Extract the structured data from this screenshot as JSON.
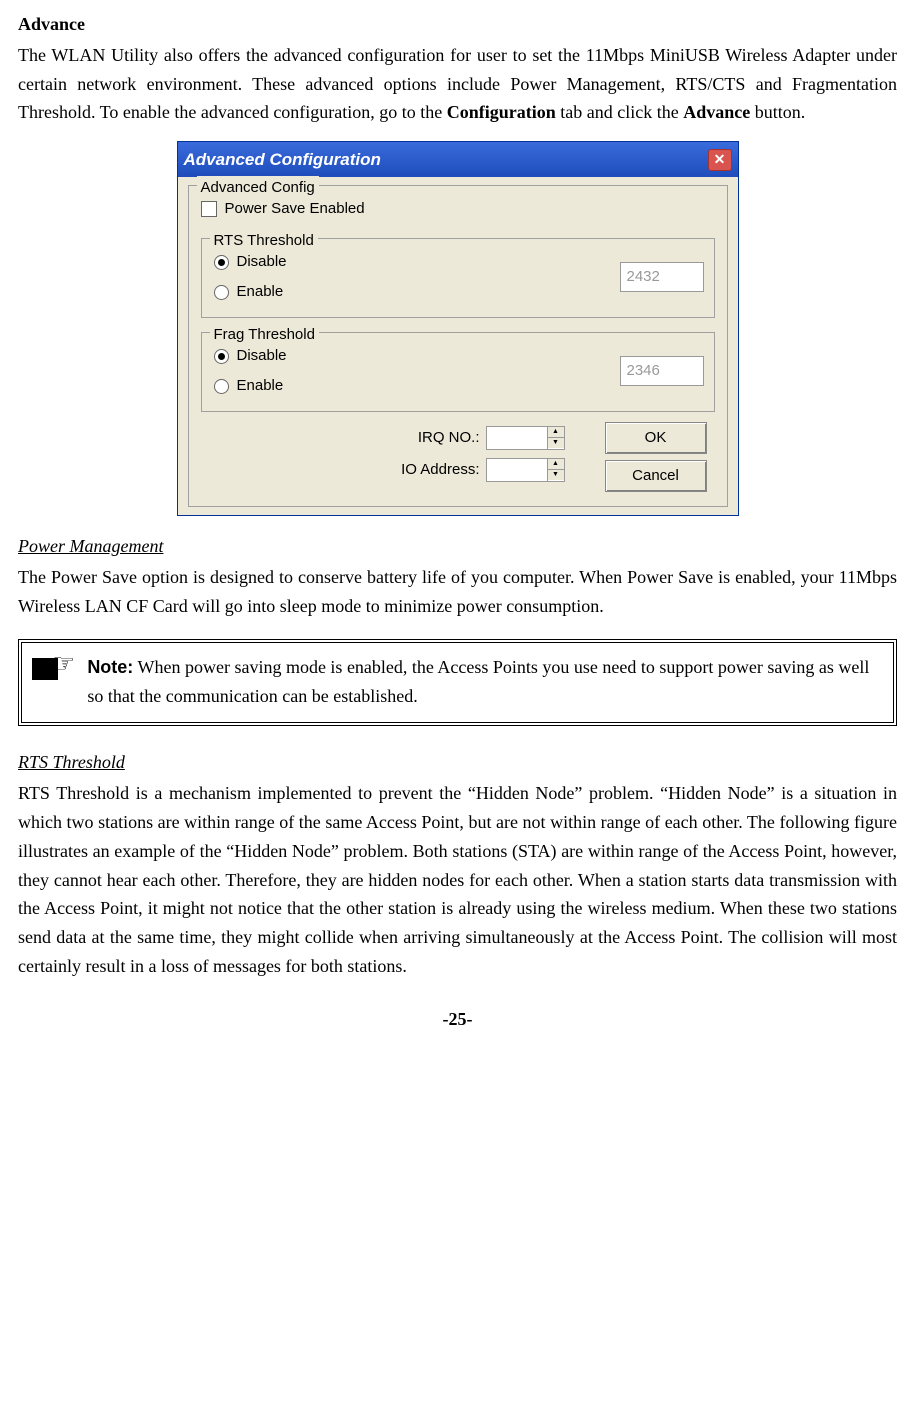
{
  "heading_advance": "Advance",
  "intro_para_pre": "The WLAN Utility also offers the advanced configuration for user to set the 11Mbps MiniUSB Wireless Adapter under certain network environment.  These advanced options include Power Management, RTS/CTS and Fragmentation Threshold.  To enable the advanced configuration, go to the ",
  "intro_bold1": "Configuration",
  "intro_mid": " tab and click the ",
  "intro_bold2": "Advance",
  "intro_end": " button.",
  "dialog": {
    "title": "Advanced Configuration",
    "adv_legend": "Advanced Config",
    "power_save": "Power Save Enabled",
    "rts": {
      "legend": "RTS Threshold",
      "disable": "Disable",
      "enable": "Enable",
      "value": "2432"
    },
    "frag": {
      "legend": "Frag Threshold",
      "disable": "Disable",
      "enable": "Enable",
      "value": "2346"
    },
    "irq_label": "IRQ NO.:",
    "io_label": "IO Address:",
    "ok": "OK",
    "cancel": "Cancel"
  },
  "pm_heading": "Power Management",
  "pm_para": "The Power Save option is designed to conserve battery life of you computer.  When Power Save is enabled, your 11Mbps Wireless LAN CF Card will go into sleep mode to minimize power consumption.",
  "note_label": "Note:",
  "note_text": " When power saving mode is enabled, the Access Points you use need to support power saving as well so that the communication can be established.",
  "rts_heading": "RTS Threshold",
  "rts_para": "RTS Threshold is a mechanism implemented to prevent the “Hidden Node” problem.  “Hidden Node” is a situation in which two stations are within range of the same Access Point, but are not within range of each other.  The following figure illustrates an example of the “Hidden Node” problem.  Both stations (STA) are within range of the Access Point, however, they cannot hear each other.  Therefore, they are hidden nodes for each other.  When a station starts data transmission with the Access Point, it might not notice that the other station is already using the wireless medium.  When these two stations send data at the same time, they might collide when arriving simultaneously at the Access Point.  The collision will most certainly result in a loss of messages for both stations.",
  "page_number": "-25-"
}
